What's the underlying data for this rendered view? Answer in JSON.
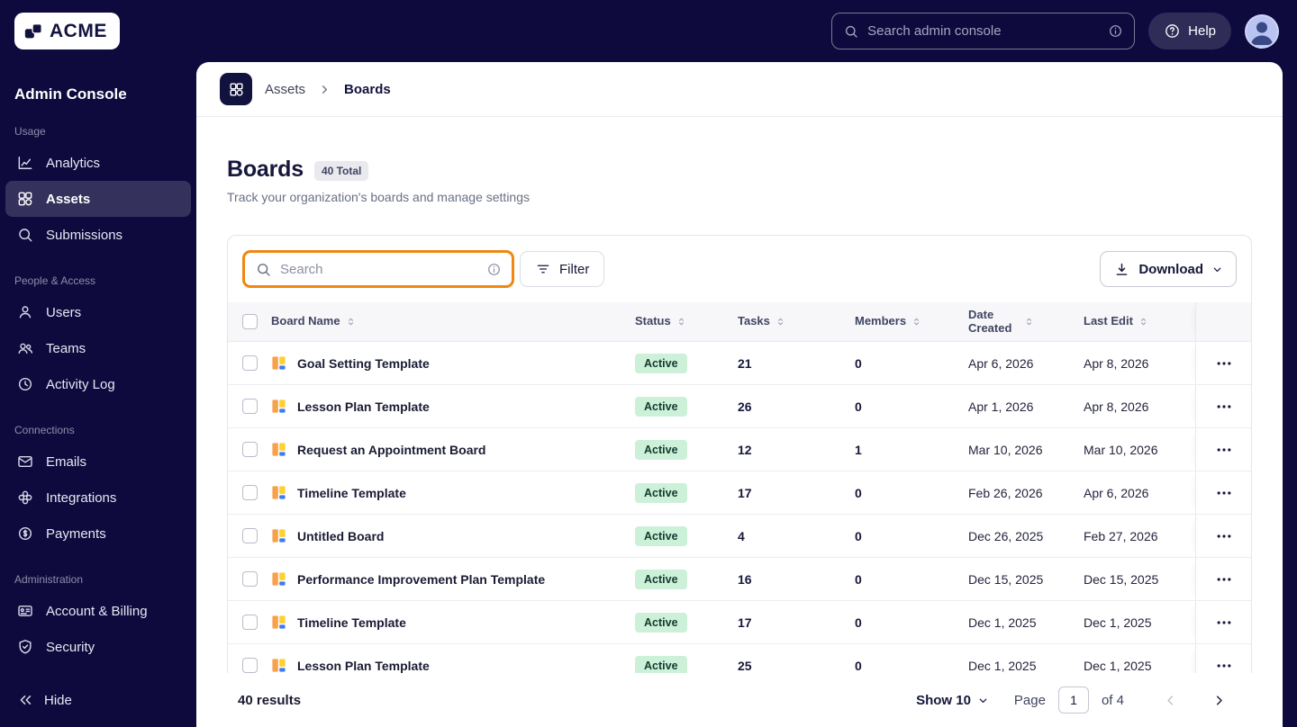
{
  "brand": {
    "logo_text": "ACME"
  },
  "topbar": {
    "search_placeholder": "Search admin console",
    "help_label": "Help"
  },
  "sidebar": {
    "title": "Admin Console",
    "sections": [
      {
        "label": "Usage",
        "items": [
          {
            "label": "Analytics",
            "icon": "analytics-icon",
            "active": false
          },
          {
            "label": "Assets",
            "icon": "assets-icon",
            "active": true
          },
          {
            "label": "Submissions",
            "icon": "search-icon",
            "active": false
          }
        ]
      },
      {
        "label": "People & Access",
        "items": [
          {
            "label": "Users",
            "icon": "user-icon",
            "active": false
          },
          {
            "label": "Teams",
            "icon": "teams-icon",
            "active": false
          },
          {
            "label": "Activity Log",
            "icon": "activity-log-icon",
            "active": false
          }
        ]
      },
      {
        "label": "Connections",
        "items": [
          {
            "label": "Emails",
            "icon": "mail-icon",
            "active": false
          },
          {
            "label": "Integrations",
            "icon": "integrations-icon",
            "active": false
          },
          {
            "label": "Payments",
            "icon": "payments-icon",
            "active": false
          }
        ]
      },
      {
        "label": "Administration",
        "items": [
          {
            "label": "Account & Billing",
            "icon": "billing-card-icon",
            "active": false
          },
          {
            "label": "Security",
            "icon": "shield-icon",
            "active": false
          }
        ]
      }
    ],
    "hide_label": "Hide"
  },
  "breadcrumb": {
    "parent": "Assets",
    "current": "Boards"
  },
  "page": {
    "title": "Boards",
    "total_badge": "40 Total",
    "subtitle": "Track your organization's boards and manage settings"
  },
  "toolbar": {
    "search_placeholder": "Search",
    "filter_label": "Filter",
    "download_label": "Download"
  },
  "table": {
    "columns": [
      "Board Name",
      "Status",
      "Tasks",
      "Members",
      "Date Created",
      "Last Edit"
    ],
    "rows": [
      {
        "name": "Goal Setting Template",
        "status": "Active",
        "tasks": "21",
        "members": "0",
        "date_created": "Apr 6, 2026",
        "last_edit": "Apr 8, 2026"
      },
      {
        "name": "Lesson Plan Template",
        "status": "Active",
        "tasks": "26",
        "members": "0",
        "date_created": "Apr 1, 2026",
        "last_edit": "Apr 8, 2026"
      },
      {
        "name": "Request an Appointment Board",
        "status": "Active",
        "tasks": "12",
        "members": "1",
        "date_created": "Mar 10, 2026",
        "last_edit": "Mar 10, 2026"
      },
      {
        "name": "Timeline Template",
        "status": "Active",
        "tasks": "17",
        "members": "0",
        "date_created": "Feb 26, 2026",
        "last_edit": "Apr 6, 2026"
      },
      {
        "name": "Untitled Board",
        "status": "Active",
        "tasks": "4",
        "members": "0",
        "date_created": "Dec 26, 2025",
        "last_edit": "Feb 27, 2026"
      },
      {
        "name": "Performance Improvement Plan Template",
        "status": "Active",
        "tasks": "16",
        "members": "0",
        "date_created": "Dec 15, 2025",
        "last_edit": "Dec 15, 2025"
      },
      {
        "name": "Timeline Template",
        "status": "Active",
        "tasks": "17",
        "members": "0",
        "date_created": "Dec 1, 2025",
        "last_edit": "Dec 1, 2025"
      },
      {
        "name": "Lesson Plan Template",
        "status": "Active",
        "tasks": "25",
        "members": "0",
        "date_created": "Dec 1, 2025",
        "last_edit": "Dec 1, 2025"
      }
    ]
  },
  "footer": {
    "results": "40 results",
    "show_label": "Show 10",
    "page_label": "Page",
    "page_value": "1",
    "of_label": "of 4"
  },
  "colors": {
    "sidebar_bg": "#0E0A3D",
    "search_highlight_orange": "#F08712",
    "active_badge_bg": "#CDF0D9",
    "active_badge_text": "#123B2F",
    "link_navy": "#16173A",
    "avatar_bg": "#B9C4F2"
  },
  "icons": [
    "acme-logo-icon",
    "search-icon",
    "info-icon",
    "help-icon",
    "avatar-person-icon",
    "analytics-icon",
    "assets-icon",
    "user-icon",
    "teams-icon",
    "activity-log-icon",
    "mail-icon",
    "integrations-icon",
    "payments-icon",
    "billing-card-icon",
    "shield-icon",
    "collapse-sidebar-icon",
    "apps-grid-icon",
    "chevron-right-icon",
    "filter-icon",
    "download-icon",
    "chevron-down-icon",
    "sort-icon",
    "board-icon",
    "ellipsis-icon",
    "chevron-left-icon"
  ]
}
